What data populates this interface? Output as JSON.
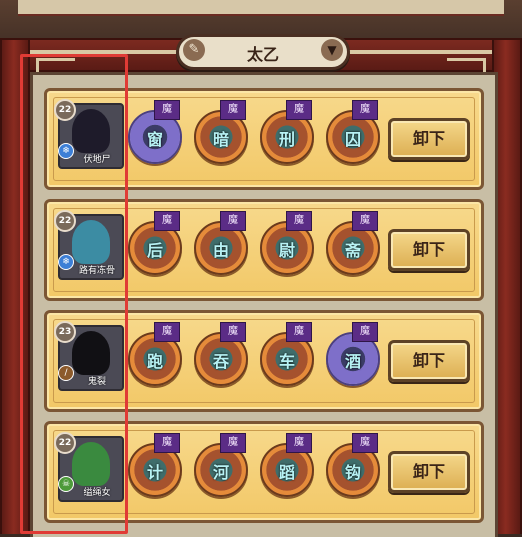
{
  "header": {
    "title": "太乙",
    "left_icon": "brush-icon",
    "right_icon": "chevron-down-icon"
  },
  "colors": {
    "highlight": "#e03b35",
    "tag_purple": "#5b2c86",
    "card_gold": "#f2c867"
  },
  "rows": [
    {
      "level": "22",
      "name": "伏地尸",
      "element_icon": "snowflake-icon",
      "element_color": "#3d7fd6",
      "button": "卸下",
      "slots": [
        {
          "tag": "魔",
          "glyph": "窗",
          "style": "purple"
        },
        {
          "tag": "魔",
          "glyph": "暗",
          "style": "orange"
        },
        {
          "tag": "魔",
          "glyph": "刑",
          "style": "orange"
        },
        {
          "tag": "魔",
          "glyph": "囚",
          "style": "orange"
        }
      ]
    },
    {
      "level": "22",
      "name": "路有冻骨",
      "element_icon": "snowflake-icon",
      "element_color": "#3d7fd6",
      "button": "卸下",
      "slots": [
        {
          "tag": "魔",
          "glyph": "后",
          "style": "orange"
        },
        {
          "tag": "魔",
          "glyph": "由",
          "style": "orange"
        },
        {
          "tag": "魔",
          "glyph": "尉",
          "style": "orange"
        },
        {
          "tag": "魔",
          "glyph": "斋",
          "style": "orange"
        }
      ]
    },
    {
      "level": "23",
      "name": "鬼裂",
      "element_icon": "blade-icon",
      "element_color": "#8c5a2b",
      "button": "卸下",
      "slots": [
        {
          "tag": "魔",
          "glyph": "跑",
          "style": "orange"
        },
        {
          "tag": "魔",
          "glyph": "吞",
          "style": "orange"
        },
        {
          "tag": "魔",
          "glyph": "车",
          "style": "orange"
        },
        {
          "tag": "魔",
          "glyph": "酒",
          "style": "purple"
        }
      ]
    },
    {
      "level": "22",
      "name": "缢绳女",
      "element_icon": "skull-icon",
      "element_color": "#4d9a3a",
      "button": "卸下",
      "slots": [
        {
          "tag": "魔",
          "glyph": "计",
          "style": "orange"
        },
        {
          "tag": "魔",
          "glyph": "河",
          "style": "orange"
        },
        {
          "tag": "魔",
          "glyph": "蹈",
          "style": "orange"
        },
        {
          "tag": "魔",
          "glyph": "钩",
          "style": "orange"
        }
      ]
    }
  ]
}
